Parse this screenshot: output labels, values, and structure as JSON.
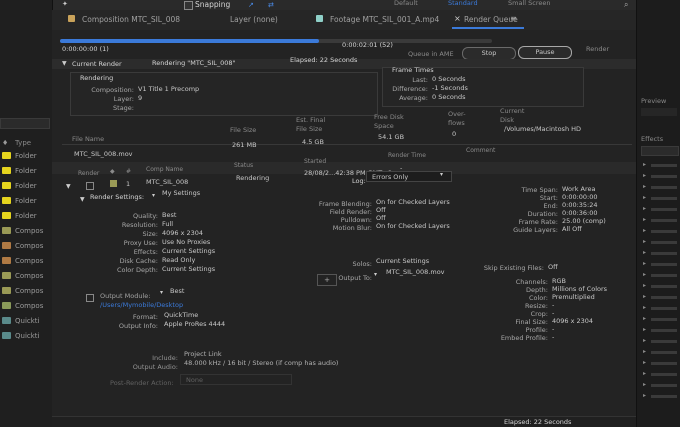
{
  "topbar": {
    "snapping": "Snapping",
    "workspaces": [
      "Default",
      "Standard",
      "Small Screen"
    ]
  },
  "left_panel": {
    "type_header": "Type",
    "items": [
      {
        "label": "Folder",
        "color": "#e6d51e"
      },
      {
        "label": "Folder",
        "color": "#e6d51e"
      },
      {
        "label": "Folder",
        "color": "#e6d51e"
      },
      {
        "label": "Folder",
        "color": "#e6d51e"
      },
      {
        "label": "Folder",
        "color": "#e6d51e"
      },
      {
        "label": "Compos",
        "color": "#9a9a56"
      },
      {
        "label": "Compos",
        "color": "#b07a44"
      },
      {
        "label": "Compos",
        "color": "#b07a44"
      },
      {
        "label": "Compos",
        "color": "#9a9a56"
      },
      {
        "label": "Compos",
        "color": "#9a9a56"
      },
      {
        "label": "Compos",
        "color": "#8a9a5a"
      },
      {
        "label": "Quickti",
        "color": "#5a8a8a"
      },
      {
        "label": "Quickti",
        "color": "#5a8a8a"
      }
    ]
  },
  "tabs": {
    "composition": "Composition MTC_SIL_008",
    "layer": "Layer (none)",
    "footage": "Footage MTC_SIL_001_A.mp4",
    "render_queue": "Render Queue"
  },
  "progress": {
    "fraction": 0.6,
    "start_time": "0:00:00:00 (1)",
    "end_time": "0:00:02:01 (52)",
    "queue_in_ame": "Queue in AME",
    "stop_label": "Stop",
    "pause_label": "Pause",
    "render_label": "Render"
  },
  "current_render": {
    "header": "Current Render",
    "rendering_status": "Rendering \"MTC_SIL_008\"",
    "elapsed": "Elapsed: 22 Seconds",
    "rendering_title": "Rendering",
    "composition_label": "Composition:",
    "composition_value": "V1 Title 1 Precomp",
    "layer_label": "Layer:",
    "layer_value": "9",
    "stage_label": "Stage:",
    "stage_value": "",
    "frame_times_title": "Frame Times",
    "last_label": "Last:",
    "last_value": "0 Seconds",
    "difference_label": "Difference:",
    "difference_value": "-1 Seconds",
    "average_label": "Average:",
    "average_value": "0 Seconds"
  },
  "file_table": {
    "headers": {
      "file_name": "File Name",
      "file_size": "File Size",
      "est_final": "Est. Final File Size",
      "free_disk": "Free Disk Space",
      "overflows": "Over-flows",
      "current_disk": "Current Disk"
    },
    "row": {
      "file_name": "MTC_SIL_008.mov",
      "file_size": "261 MB",
      "est_final": "4.5 GB",
      "free_disk": "54.1 GB",
      "overflows": "0",
      "current_disk": "/Volumes/Macintosh HD"
    }
  },
  "queue_table": {
    "headers": {
      "render": "Render",
      "hash": "#",
      "comp_name": "Comp Name",
      "status": "Status",
      "started": "Started",
      "render_time": "Render Time",
      "comment": "Comment"
    },
    "row": {
      "index": "1",
      "comp_name": "MTC_SIL_008",
      "status": "Rendering",
      "started": "28/08/2...42:38 PM GMT+8",
      "render_time": "-"
    }
  },
  "render_settings": {
    "label": "Render Settings:",
    "value": "My Settings",
    "log_label": "Log:",
    "log_value": "Errors Only",
    "left": [
      {
        "label": "Quality:",
        "value": "Best"
      },
      {
        "label": "Resolution:",
        "value": "Full"
      },
      {
        "label": "Size:",
        "value": "4096 x 2304"
      },
      {
        "label": "Proxy Use:",
        "value": "Use No Proxies"
      },
      {
        "label": "Effects:",
        "value": "Current Settings"
      },
      {
        "label": "Disk Cache:",
        "value": "Read Only"
      },
      {
        "label": "Color Depth:",
        "value": "Current Settings"
      }
    ],
    "middle": [
      {
        "label": "Frame Blending:",
        "value": "On for Checked Layers"
      },
      {
        "label": "Field Render:",
        "value": "Off"
      },
      {
        "label": "Pulldown:",
        "value": "Off"
      },
      {
        "label": "Motion Blur:",
        "value": "On for Checked Layers"
      }
    ],
    "solos_label": "Solos:",
    "solos_value": "Current Settings",
    "right": [
      {
        "label": "Time Span:",
        "value": "Work Area"
      },
      {
        "label": "Start:",
        "value": "0:00:00:00"
      },
      {
        "label": "End:",
        "value": "0:00:35:24"
      },
      {
        "label": "Duration:",
        "value": "0:00:36:00"
      },
      {
        "label": "Frame Rate:",
        "value": "25.00 (comp)"
      },
      {
        "label": "Guide Layers:",
        "value": "All Off"
      }
    ],
    "skip_label": "Skip Existing Files:",
    "skip_value": "Off"
  },
  "output_module": {
    "label": "Output Module:",
    "value": "Best",
    "path": "/Users/Mymobile/Desktop",
    "output_to_label": "Output To:",
    "output_to_value": "MTC_SIL_008.mov",
    "format_label": "Format:",
    "format_value": "QuickTime",
    "info_label": "Output Info:",
    "info_value": "Apple ProRes 4444",
    "include_label": "Include:",
    "include_value": "Project Link",
    "audio_label": "Output Audio:",
    "audio_value": "48.000 kHz / 16 bit / Stereo (if comp has audio)",
    "right": [
      {
        "label": "Channels:",
        "value": "RGB"
      },
      {
        "label": "Depth:",
        "value": "Millions of Colors"
      },
      {
        "label": "Color:",
        "value": "Premultiplied"
      },
      {
        "label": "Resize:",
        "value": "-"
      },
      {
        "label": "Crop:",
        "value": "-"
      },
      {
        "label": "Final Size:",
        "value": "4096 x 2304"
      },
      {
        "label": "Profile:",
        "value": "-"
      },
      {
        "label": "Embed Profile:",
        "value": "-"
      }
    ]
  },
  "post_render": {
    "label": "Post-Render Action:",
    "value": "None"
  },
  "footer": {
    "elapsed": "Elapsed: 22 Seconds"
  },
  "right_panel": {
    "preview": "Preview",
    "effects": "Effects"
  }
}
